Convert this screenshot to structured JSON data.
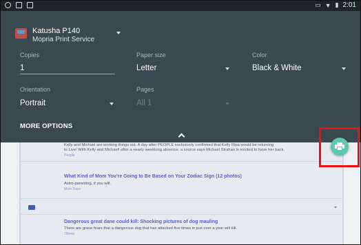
{
  "status_bar": {
    "time": "2:01",
    "left_icons": [
      "android-icon",
      "image-icon",
      "sd-card-icon"
    ],
    "right_icons": [
      "vibrate-icon",
      "wifi-icon",
      "battery-icon"
    ]
  },
  "printer": {
    "name": "Katusha P140",
    "service": "Mopria Print Service",
    "icon": "printer-app-icon"
  },
  "options": {
    "copies": {
      "label": "Copies",
      "value": "1"
    },
    "paper_size": {
      "label": "Paper size",
      "value": "Letter"
    },
    "color": {
      "label": "Color",
      "value": "Black & White"
    },
    "orientation": {
      "label": "Orientation",
      "value": "Portrait"
    },
    "pages": {
      "label": "Pages",
      "value": "All 1"
    }
  },
  "more_options_label": "MORE OPTIONS",
  "print_fab": {
    "icon": "print-icon",
    "color": "#5cc8b4",
    "highlight_color": "#ee1111"
  },
  "background_page": {
    "article_1": {
      "excerpt_line1": "Kelly and Michael are working things out. A day after PEOPLE exclusively confirmed that Kelly Ripa would be returning",
      "excerpt_line2": "to Live! With Kelly and Michael! after a nearly weeklong absence, a source says Michael Strahan is excited to have her back.",
      "source": "People"
    },
    "article_2": {
      "title": "What Kind of Mom You're Going to Be Based on Your Zodiac Sign (12 photos)",
      "description": "Astro-parenting, if you will.",
      "source": "Mom Daze"
    },
    "article_3": {
      "title": "Dangerous great dane could kill: Shocking pictures of dog mauling",
      "description": "There are grave fears that a dangerous dog that has attacked five times in just over a year will kill.",
      "source": "7News"
    }
  }
}
